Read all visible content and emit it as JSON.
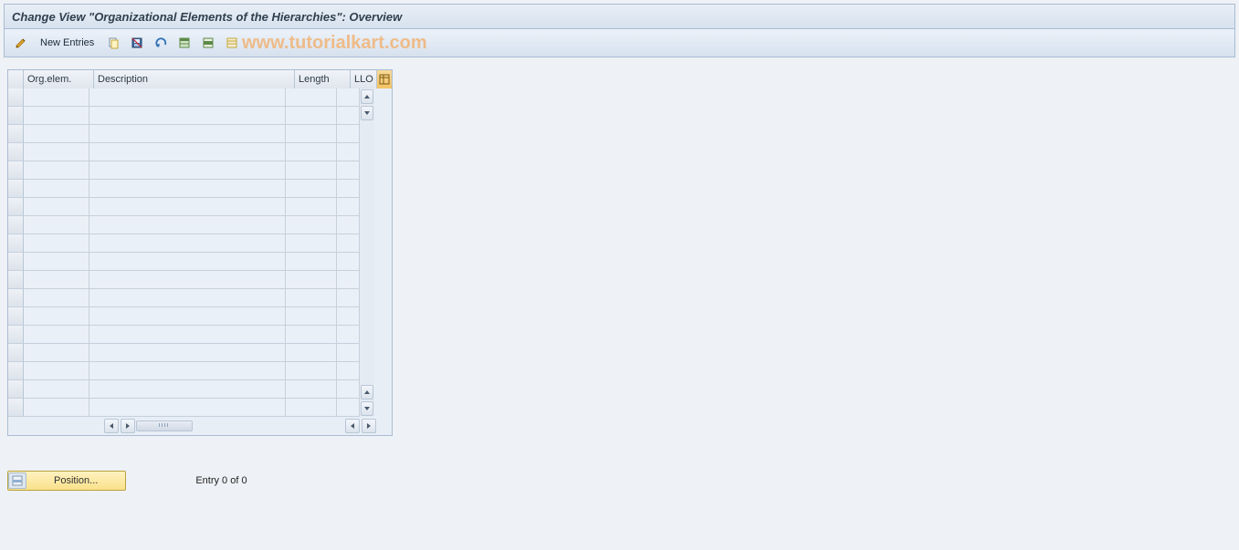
{
  "title": "Change View \"Organizational Elements of the Hierarchies\": Overview",
  "toolbar": {
    "new_entries_label": "New Entries"
  },
  "watermark": "www.tutorialkart.com",
  "table": {
    "columns": {
      "org_elem": "Org.elem.",
      "description": "Description",
      "length": "Length",
      "llo": "LLO"
    },
    "row_count": 18
  },
  "footer": {
    "position_label": "Position...",
    "entry_text": "Entry 0 of 0"
  },
  "icons": {
    "change": "change-icon",
    "copy": "copy-icon",
    "save": "save-icon",
    "undo": "undo-icon",
    "select_all": "select-all-icon",
    "select_block": "select-block-icon",
    "deselect": "deselect-icon",
    "table_settings": "table-settings-icon",
    "position": "position-icon"
  }
}
